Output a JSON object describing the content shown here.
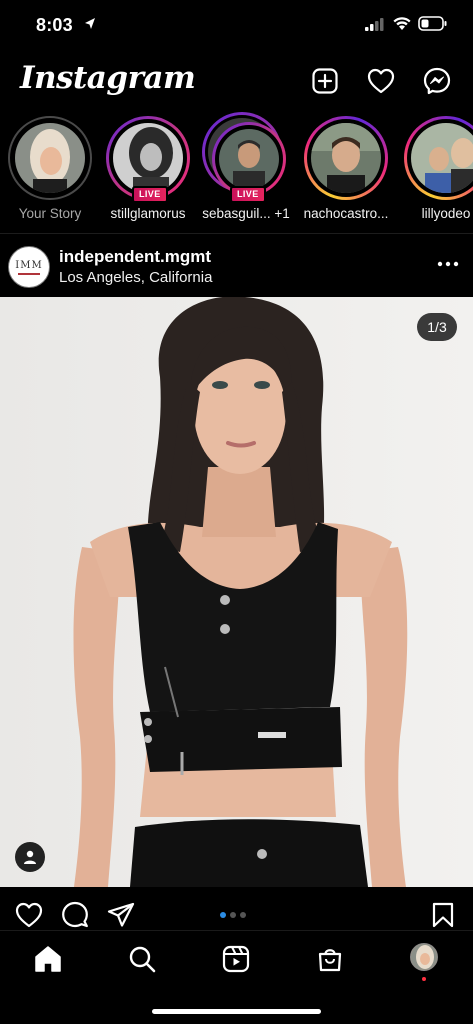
{
  "status_bar": {
    "time": "8:03"
  },
  "header": {
    "logo": "Instagram"
  },
  "stories": [
    {
      "name": "Your Story",
      "live": false
    },
    {
      "name": "stillglamorus",
      "live": true,
      "badge": "LIVE"
    },
    {
      "name": "sebasguil... +1",
      "live": true,
      "badge": "LIVE"
    },
    {
      "name": "nachocastro...",
      "live": false
    },
    {
      "name": "lillyodeo",
      "live": false
    }
  ],
  "post": {
    "avatar_text": "IMM",
    "username": "independent.mgmt",
    "location": "Los Angeles, California",
    "carousel_counter": "1/3",
    "carousel": {
      "total": 3,
      "active": 1
    }
  },
  "colors": {
    "accent_blue": "#2b8ce4",
    "live_red": "#e5245e",
    "notification": "#ff3040"
  }
}
